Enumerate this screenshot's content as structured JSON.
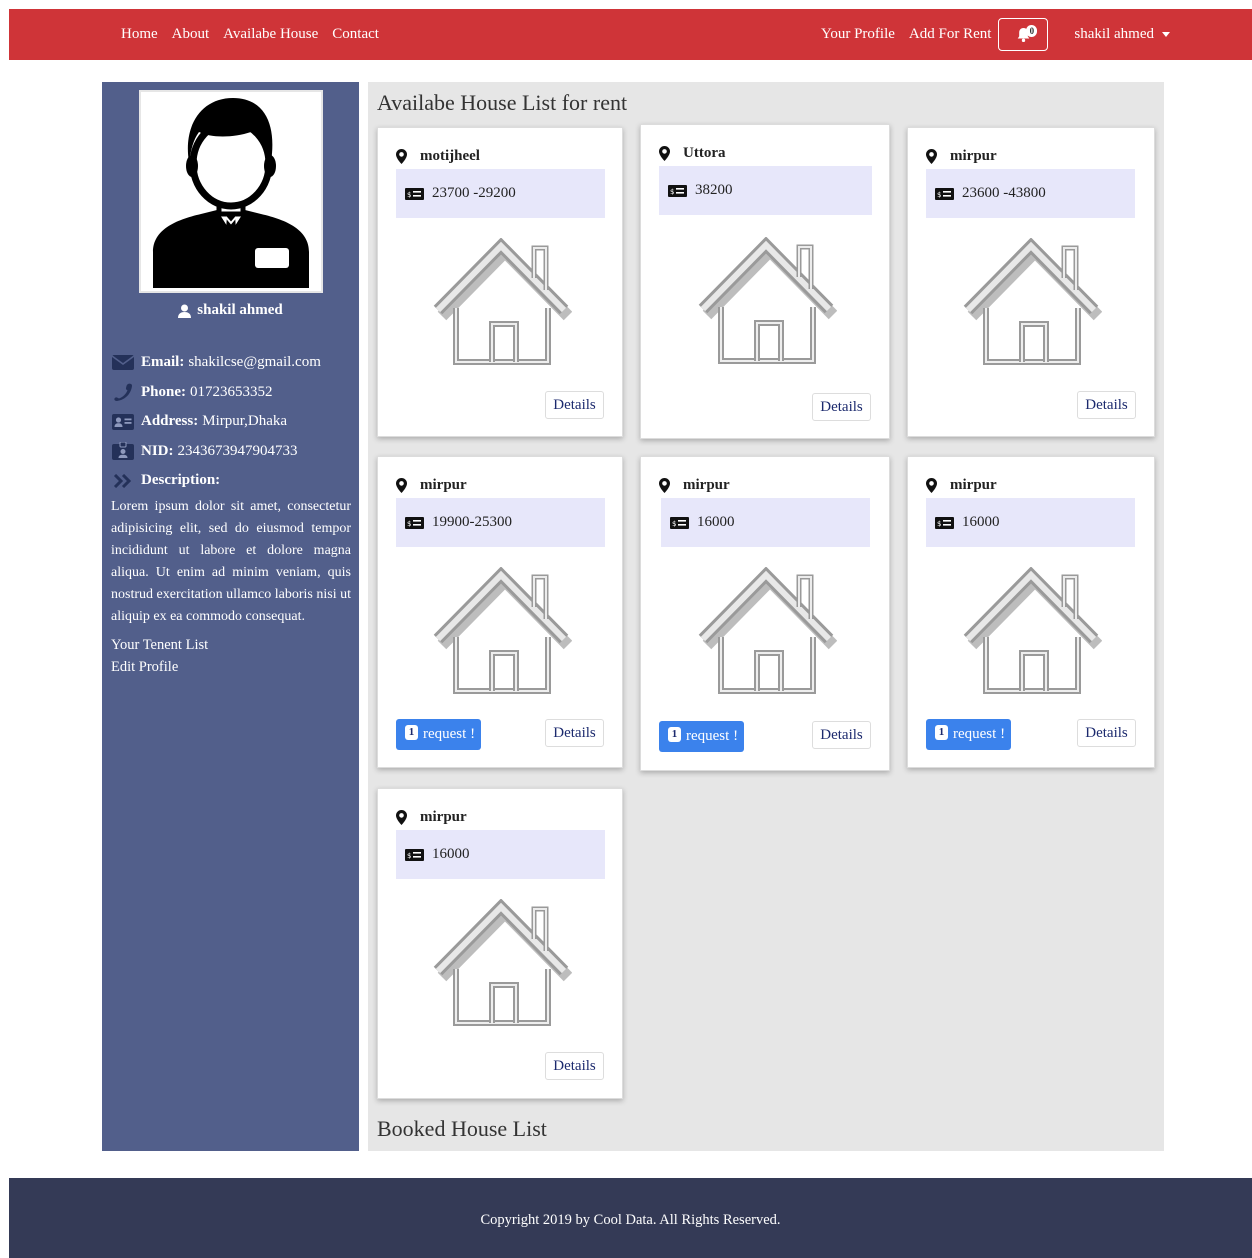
{
  "nav": {
    "links": [
      "Home",
      "About",
      "Availabe House",
      "Contact"
    ],
    "right_links": [
      "Your Profile",
      "Add For Rent"
    ],
    "notification_count": "0",
    "user_name": "shakil ahmed"
  },
  "sidebar": {
    "user_name": "shakil ahmed",
    "email_label": "Email:",
    "email": "shakilcse@gmail.com",
    "phone_label": "Phone:",
    "phone": "01723653352",
    "address_label": "Address:",
    "address": "Mirpur,Dhaka",
    "nid_label": "NID:",
    "nid": "2343673947904733",
    "description_label": "Description:",
    "description": "Lorem ipsum dolor sit amet, consectetur adipisicing elit, sed do eiusmod tempor incididunt ut labore et dolore magna aliqua. Ut enim ad minim veniam, quis nostrud exercitation ullamco laboris nisi ut aliquip ex ea commodo consequat.",
    "tenant_link": "Your Tenent List",
    "edit_link": "Edit Profile"
  },
  "main": {
    "available_title": "Availabe House List for rent",
    "booked_title": "Booked House List",
    "details_label": "Details",
    "request_label": "request !",
    "houses": [
      {
        "location": "motijheel",
        "price": "23700 -29200",
        "requests": null
      },
      {
        "location": "Uttora",
        "price": "38200",
        "requests": null
      },
      {
        "location": "mirpur",
        "price": "23600 -43800",
        "requests": null
      },
      {
        "location": "mirpur",
        "price": "19900-25300",
        "requests": "1"
      },
      {
        "location": "mirpur",
        "price": "16000",
        "requests": "1"
      },
      {
        "location": "mirpur",
        "price": "16000",
        "requests": "1"
      },
      {
        "location": "mirpur",
        "price": "16000",
        "requests": null
      }
    ]
  },
  "footer": {
    "copyright": "Copyright 2019 by Cool Data. All Rights Reserved."
  },
  "icons": {
    "location": "map-marker-icon",
    "price": "money-bill-icon",
    "notification": "bell-icon",
    "user": "user-icon",
    "email": "envelope-icon",
    "phone": "phone-icon",
    "address": "address-card-icon",
    "nid": "id-badge-icon",
    "description": "angle-double-right-icon",
    "house": "house-image"
  },
  "colors": {
    "navbar": "#cf3438",
    "sidebar": "#525f8b",
    "main_bg": "#e6e6e6",
    "price_box": "#e7e7fa",
    "request_button": "#3b82ec",
    "footer": "#343a56"
  }
}
